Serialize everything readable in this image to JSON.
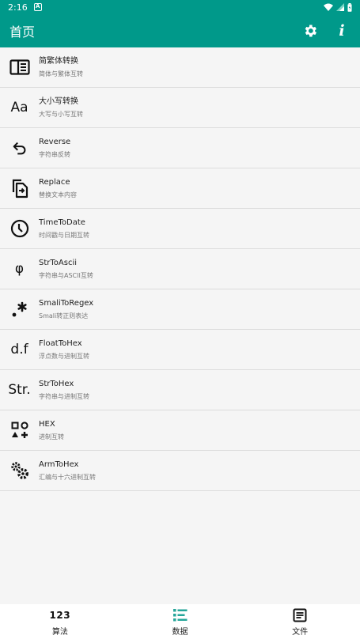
{
  "status_bar": {
    "time": "2:16",
    "badge": "A"
  },
  "app_bar": {
    "title": "首页"
  },
  "items": [
    {
      "icon": "book-open-icon",
      "title": "简繁体转换",
      "subtitle": "简体与繁体互转"
    },
    {
      "icon": "text-case-icon",
      "glyph": "Aa",
      "title": "大小写转换",
      "subtitle": "大写与小写互转"
    },
    {
      "icon": "undo-arrow-icon",
      "title": "Reverse",
      "subtitle": "字符串反转"
    },
    {
      "icon": "swap-file-icon",
      "title": "Replace",
      "subtitle": "替换文本内容"
    },
    {
      "icon": "clock-icon",
      "title": "TimeToDate",
      "subtitle": "时间戳与日期互转"
    },
    {
      "icon": "phi-icon",
      "glyph": "φ",
      "title": "StrToAscii",
      "subtitle": "字符串与ASCII互转"
    },
    {
      "icon": "regex-icon",
      "title": "SmaliToRegex",
      "subtitle": "Smali转正则表达"
    },
    {
      "icon": "float-icon",
      "glyph": "d.f",
      "title": "FloatToHex",
      "subtitle": "浮点数与进制互转"
    },
    {
      "icon": "str-icon",
      "glyph": "Str.",
      "title": "StrToHex",
      "subtitle": "字符串与进制互转"
    },
    {
      "icon": "shapes-icon",
      "title": "HEX",
      "subtitle": "进制互转"
    },
    {
      "icon": "gears-icon",
      "title": "ArmToHex",
      "subtitle": "汇编与十六进制互转"
    }
  ],
  "bottom_nav": [
    {
      "icon": "numbers-icon",
      "glyph": "123",
      "label": "算法"
    },
    {
      "icon": "list-icon",
      "label": "数据"
    },
    {
      "icon": "document-icon",
      "label": "文件"
    }
  ],
  "colors": {
    "primary": "#00998a",
    "background": "#f5f5f5",
    "active_nav": "#26a69a"
  }
}
